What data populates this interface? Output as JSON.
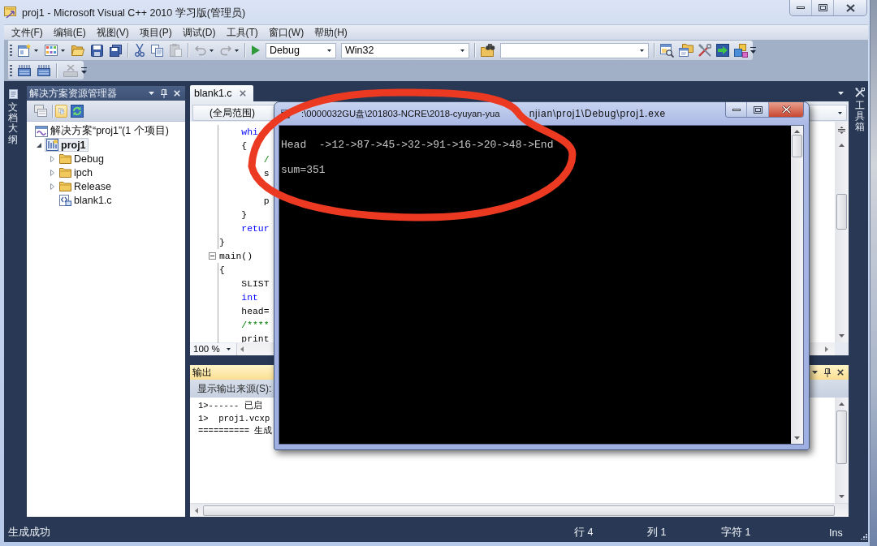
{
  "window": {
    "title": "proj1 - Microsoft Visual C++ 2010 学习版(管理员)"
  },
  "menu": [
    "文件(F)",
    "编辑(E)",
    "视图(V)",
    "项目(P)",
    "调试(D)",
    "工具(T)",
    "窗口(W)",
    "帮助(H)"
  ],
  "toolbars": [
    {
      "items": [
        {
          "kind": "new_project",
          "disabled": false
        },
        {
          "kind": "add_item",
          "disabled": false
        },
        {
          "kind": "open",
          "disabled": false
        },
        {
          "kind": "save",
          "disabled": false
        },
        {
          "kind": "save_all",
          "disabled": false
        },
        {
          "kind": "separator"
        },
        {
          "kind": "cut",
          "disabled": false
        },
        {
          "kind": "copy",
          "disabled": false
        },
        {
          "kind": "paste",
          "disabled": true
        },
        {
          "kind": "separator"
        },
        {
          "kind": "undo",
          "disabled": true
        },
        {
          "kind": "redo",
          "disabled": true
        },
        {
          "kind": "separator"
        },
        {
          "kind": "start",
          "disabled": false
        },
        {
          "kind": "config_combo",
          "value": "Debug"
        },
        {
          "kind": "platform_combo",
          "value": "Win32"
        },
        {
          "kind": "separator"
        },
        {
          "kind": "find_in_files",
          "disabled": false
        },
        {
          "kind": "find_combo"
        },
        {
          "kind": "separator"
        },
        {
          "kind": "solution_explorer",
          "disabled": false
        },
        {
          "kind": "properties",
          "disabled": false
        },
        {
          "kind": "tools",
          "disabled": false
        },
        {
          "kind": "start_page",
          "disabled": false
        },
        {
          "kind": "extensions",
          "disabled": false
        }
      ]
    },
    {
      "items": [
        {
          "kind": "ticked_bar",
          "disabled": false
        },
        {
          "kind": "ticked_bar",
          "disabled": false
        },
        {
          "kind": "separator"
        },
        {
          "kind": "cross_tray",
          "disabled": true
        }
      ]
    }
  ],
  "left_tab": {
    "label": "文档大纲"
  },
  "solution_explorer": {
    "title": "解决方案资源管理器",
    "active": false,
    "toolbar": [
      {
        "kind": "windows",
        "pressed": false
      },
      {
        "kind": "files",
        "pressed": true
      },
      {
        "kind": "refresh",
        "pressed": false
      }
    ],
    "tree": [
      {
        "label": "解决方案“proj1”(1 个项目)",
        "kind": "solution",
        "selected": false,
        "children": [
          {
            "label": "proj1",
            "kind": "project",
            "selected": true,
            "expanded": true,
            "children": [
              {
                "label": "Debug",
                "kind": "folder",
                "selected": false,
                "expanded": false
              },
              {
                "label": "ipch",
                "kind": "folder",
                "selected": false,
                "expanded": false
              },
              {
                "label": "Release",
                "kind": "folder",
                "selected": false,
                "expanded": false
              },
              {
                "label": "blank1.c",
                "kind": "file",
                "selected": false
              }
            ]
          }
        ]
      }
    ]
  },
  "editor": {
    "tabs": [
      {
        "label": "blank1.c",
        "selected": true
      }
    ],
    "scope": "(全局范围)",
    "code": [
      {
        "kind": "keyword",
        "text": "    whi"
      },
      {
        "kind": "plain",
        "text": "    {"
      },
      {
        "kind": "comment",
        "text": "        /"
      },
      {
        "kind": "plain",
        "text": "        s"
      },
      {
        "kind": "blank"
      },
      {
        "kind": "plain",
        "text": "        p"
      },
      {
        "kind": "plain",
        "text": "    }"
      },
      {
        "kind": "keyword",
        "text": "    retur"
      },
      {
        "kind": "plain",
        "text": "}"
      },
      {
        "kind": "fold",
        "text": "main()"
      },
      {
        "kind": "plain",
        "text": "{"
      },
      {
        "kind": "plain",
        "text": "    SLIST"
      },
      {
        "kind": "keyword",
        "text": "    int"
      },
      {
        "kind": "plain",
        "text": "    head="
      },
      {
        "kind": "comment",
        "text": "    /****"
      },
      {
        "kind": "plain",
        "text": "    print"
      }
    ],
    "zoom": "100 %"
  },
  "output": {
    "title": "输出",
    "active": true,
    "source_label": "显示输出来源(S):",
    "lines": [
      "1>------ 已启",
      "1>  proj1.vcxp",
      "========== 生成"
    ]
  },
  "console": {
    "title": [
      ":\\0000032GU盘\\201803-NCRE\\2018-cyuyan-yua",
      "njian\\proj1\\Debug\\proj1.exe"
    ],
    "lines": [
      "Head  ->12->87->45->32->91->16->20->48->End",
      "sum=351"
    ]
  },
  "right_tab": {
    "label": "工具箱"
  },
  "status_bar": {
    "message": "生成成功",
    "line": "行 4",
    "column": "列 1",
    "character": "字符 1",
    "mode": "Ins"
  }
}
